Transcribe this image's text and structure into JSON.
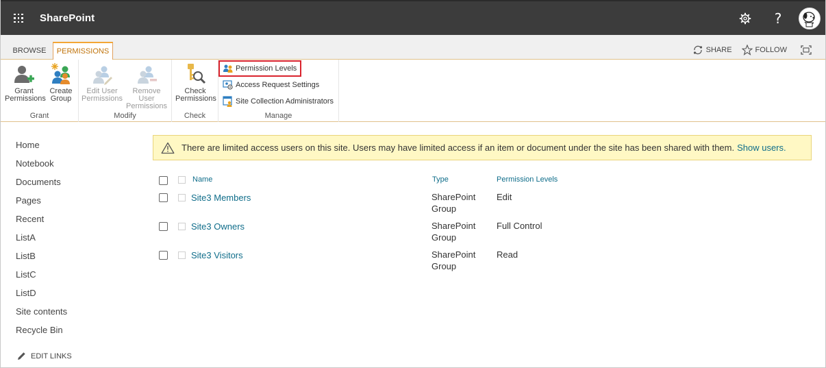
{
  "suitebar": {
    "app_name": "SharePoint",
    "help_label": "?"
  },
  "ribbon": {
    "tabs": [
      {
        "label": "BROWSE"
      },
      {
        "label": "PERMISSIONS"
      }
    ],
    "share_label": "SHARE",
    "follow_label": "FOLLOW",
    "groups": {
      "grant": {
        "label": "Grant",
        "grant_permissions": "Grant\nPermissions",
        "create_group": "Create\nGroup"
      },
      "modify": {
        "label": "Modify",
        "edit_user_permissions": "Edit User\nPermissions",
        "remove_user_permissions": "Remove User\nPermissions"
      },
      "check": {
        "label": "Check",
        "check_permissions": "Check\nPermissions"
      },
      "manage": {
        "label": "Manage",
        "permission_levels": "Permission Levels",
        "access_request_settings": "Access Request Settings",
        "site_collection_administrators": "Site Collection Administrators"
      }
    }
  },
  "leftnav": {
    "items": [
      "Home",
      "Notebook",
      "Documents",
      "Pages",
      "Recent",
      "ListA",
      "ListB",
      "ListC",
      "ListD",
      "Site contents",
      "Recycle Bin"
    ],
    "edit_links": "EDIT LINKS"
  },
  "notice": {
    "text": "There are limited access users on this site. Users may have limited access if an item or document under the site has been shared with them.",
    "link": "Show users."
  },
  "table": {
    "headers": {
      "name": "Name",
      "type": "Type",
      "levels": "Permission Levels"
    },
    "rows": [
      {
        "name": "Site3 Members",
        "type_line1": "SharePoint",
        "type_line2": "Group",
        "level": "Edit"
      },
      {
        "name": "Site3 Owners",
        "type_line1": "SharePoint",
        "type_line2": "Group",
        "level": "Full Control"
      },
      {
        "name": "Site3 Visitors",
        "type_line1": "SharePoint",
        "type_line2": "Group",
        "level": "Read"
      }
    ]
  },
  "colors": {
    "suitebar": "#3c3c3c",
    "accent": "#f3a634",
    "link": "#0f6d8a",
    "notice_bg": "#fff8c4",
    "highlight_box": "#d9232d"
  }
}
